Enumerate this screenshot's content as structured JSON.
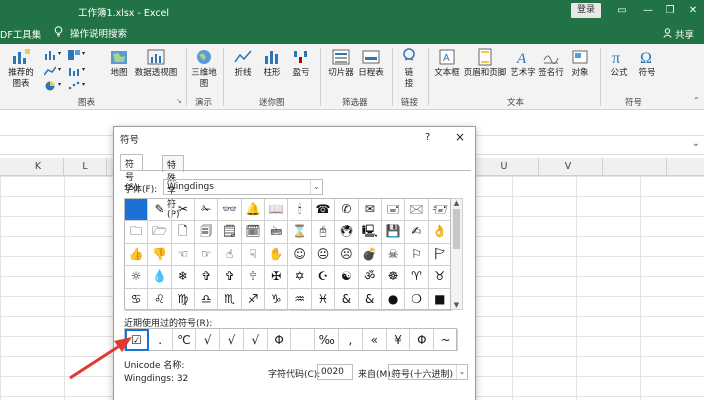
{
  "app": {
    "window_title": "工作簿1.xlsx - Excel",
    "login_label": "登录",
    "pdf_tab": "DF工具集",
    "help_label": "操作说明搜索",
    "share_label": "共享"
  },
  "ribbon": {
    "buttons": [
      {
        "label": "推荐的\n图表",
        "icon": "chart-icon"
      },
      {
        "label": "地图",
        "icon": "map-icon"
      },
      {
        "label": "数据透视图",
        "icon": "pivot-chart-icon"
      },
      {
        "label": "三维地\n图",
        "icon": "3d-map-icon"
      },
      {
        "label": "折线",
        "icon": "line-sparkline-icon"
      },
      {
        "label": "柱形",
        "icon": "column-sparkline-icon"
      },
      {
        "label": "盈亏",
        "icon": "winloss-sparkline-icon"
      },
      {
        "label": "切片器",
        "icon": "slicer-icon"
      },
      {
        "label": "日程表",
        "icon": "timeline-icon"
      },
      {
        "label": "链\n接",
        "icon": "link-icon"
      },
      {
        "label": "文本框",
        "icon": "textbox-icon"
      },
      {
        "label": "页眉和页脚",
        "icon": "header-footer-icon"
      },
      {
        "label": "艺术字",
        "icon": "wordart-icon"
      },
      {
        "label": "签名行",
        "icon": "signature-icon"
      },
      {
        "label": "对象",
        "icon": "object-icon"
      },
      {
        "label": "公式",
        "icon": "equation-icon"
      },
      {
        "label": "符号",
        "icon": "symbol-icon"
      }
    ],
    "groups": [
      "图表",
      "演示",
      "迷你图",
      "筛选器",
      "链接",
      "文本",
      "符号"
    ]
  },
  "columns": [
    "K",
    "L",
    "U",
    "V"
  ],
  "dialog": {
    "title": "符号",
    "help": "?",
    "close": "×",
    "tabs": [
      "符号(S)",
      "特殊字符(P)"
    ],
    "font_label": "字体(F):",
    "font_value": "Wingdings",
    "symbols": [
      [
        "",
        "✎",
        "✂",
        "✁",
        "👓",
        "🔔",
        "📖",
        "🕯",
        "☎",
        "✆",
        "✉",
        "🖃",
        "🖂",
        "🖅",
        "🖄"
      ],
      [
        "🗀",
        "🗁",
        "🗋",
        "🗐",
        "🗒",
        "🗓",
        "🖮",
        "⌛",
        "🖰",
        "🖲",
        "🖳",
        "💾",
        "✍",
        "👌",
        "✋"
      ],
      [
        "👍",
        "👎",
        "☜",
        "☞",
        "☝",
        "☟",
        "✋",
        "☺",
        "😐",
        "☹",
        "💣",
        "☠",
        "⚐",
        "🏱",
        "✈"
      ],
      [
        "☼",
        "💧",
        "❄",
        "✞",
        "✞",
        "🕆",
        "✠",
        "✡",
        "☪",
        "☯",
        "ॐ",
        "☸",
        "♈",
        "♉",
        "♊"
      ],
      [
        "♋",
        "♌",
        "♍",
        "♎",
        "♏",
        "♐",
        "♑",
        "♒",
        "♓",
        "&",
        "&",
        "●",
        "❍",
        "■",
        "□"
      ]
    ],
    "recent_label": "近期使用过的符号(R):",
    "recent": [
      "☑",
      ".",
      "℃",
      "√",
      "√",
      "√",
      "Φ",
      "",
      "‰",
      ",",
      "«",
      "¥",
      "Φ",
      "~",
      "‰",
      "*"
    ],
    "unicode_label": "Unicode 名称:",
    "unicode_value": "Wingdings: 32",
    "code_label": "字符代码(C):",
    "code_value": "0020",
    "from_label": "来自(M):",
    "from_value": "符号(十六进制)"
  },
  "colors": {
    "excel_green": "#217346",
    "selection_blue": "#1a73d4",
    "annotation_red": "#e03a2f"
  }
}
